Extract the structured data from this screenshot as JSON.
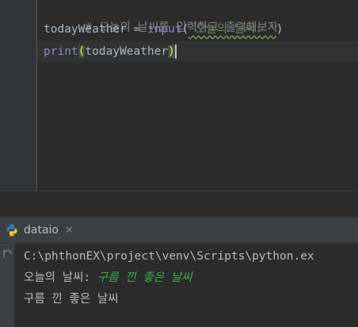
{
  "editor": {
    "lines": [
      {
        "comment": "# 오늘의 날씨를 입력하고 출력해보자"
      },
      {
        "var": "todayWeather",
        "op": " = ",
        "func": "input",
        "open": "(",
        "str": "'오늘의 날씨: '",
        "close": ")"
      },
      {
        "func": "print",
        "open": "(",
        "arg": "todayWeather",
        "close": ")"
      }
    ]
  },
  "run": {
    "tab_label": "dataio",
    "tab_icon": "python-icon",
    "close_icon": "close-icon",
    "console": {
      "command": "C:\\phthonEX\\project\\venv\\Scripts\\python.ex",
      "prompt": "오늘의 날씨: ",
      "user_input": "구름 낀 좋은 날씨",
      "output": "구름 낀 좋은 날씨"
    }
  },
  "colors": {
    "editor_bg": "#2b2b2b",
    "comment": "#808080",
    "builtin": "#8888c6",
    "string": "#6a8759",
    "user_input": "#3ab047",
    "paren_match_fg": "#ffef28"
  }
}
